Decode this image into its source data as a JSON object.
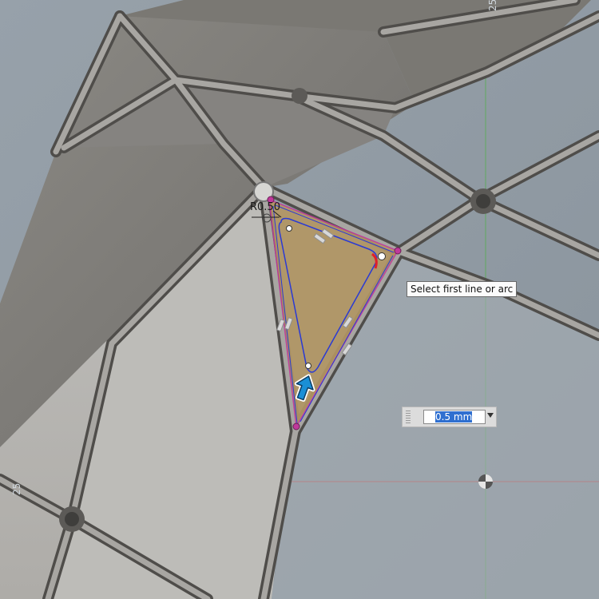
{
  "canvas": {
    "grid_axis_label_top": "25",
    "grid_axis_label_left": "25"
  },
  "sketch": {
    "radius_label": "R0.50"
  },
  "tooltip": {
    "text": "Select first line or arc"
  },
  "value_input": {
    "value": "0.5 mm"
  },
  "colors": {
    "background": "#8f9aa4",
    "face_light": "#b7b6b1",
    "face_dark": "#7c7a76",
    "profile_fill": "#b59a66",
    "profile_edge": "#c0399b",
    "sketch_line": "#2a3ad4",
    "accent_red": "#e0202a",
    "cursor": "#1a8fd6",
    "axis_red": "#d04040",
    "axis_green": "#40b040"
  },
  "icons": {
    "cursor": "cursor-arrow-icon",
    "origin": "origin-icon",
    "dropdown": "chevron-down-icon"
  }
}
